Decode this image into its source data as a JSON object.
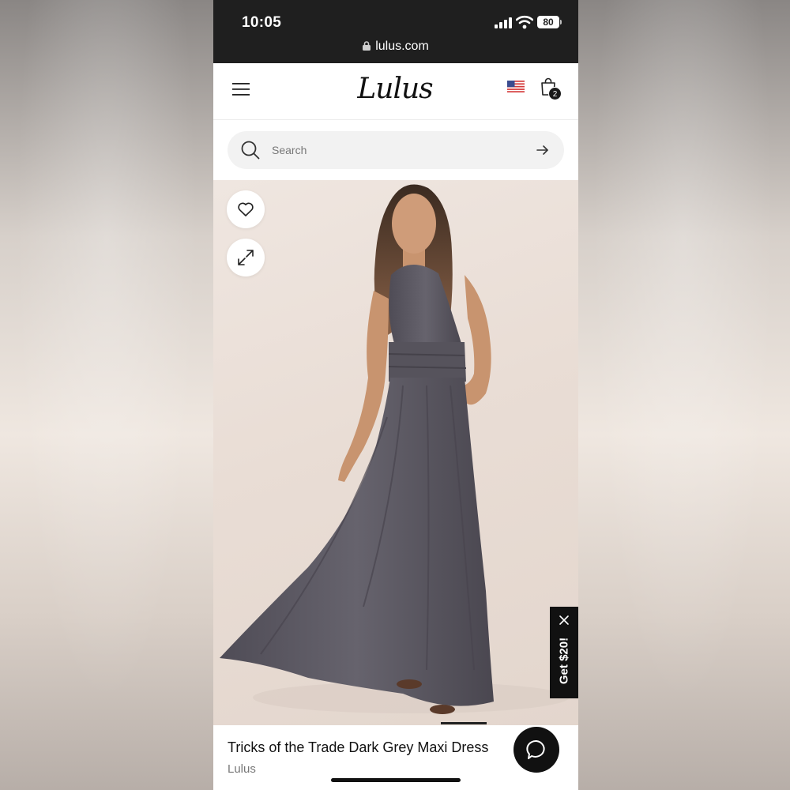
{
  "status_bar": {
    "time": "10:05",
    "battery": "80",
    "url": "lulus.com"
  },
  "header": {
    "logo": "Lulus",
    "cart_count": "2",
    "flag": "us-flag-icon"
  },
  "search": {
    "placeholder": "Search"
  },
  "product": {
    "title": "Tricks of the Trade Dark Grey Maxi Dress",
    "brand": "Lulus",
    "image_alt": "Model wearing a dark grey halter maxi dress"
  },
  "promo": {
    "label": "Get $20!"
  },
  "colors": {
    "dress": "#5d5a63",
    "background": "#ebe2dc",
    "status_bar": "#1f1f1f"
  },
  "icons": {
    "wishlist": "heart-icon",
    "expand": "expand-icon",
    "chat": "chat-icon",
    "search": "search-icon",
    "menu": "hamburger-menu-icon",
    "cart": "shopping-bag-icon"
  }
}
